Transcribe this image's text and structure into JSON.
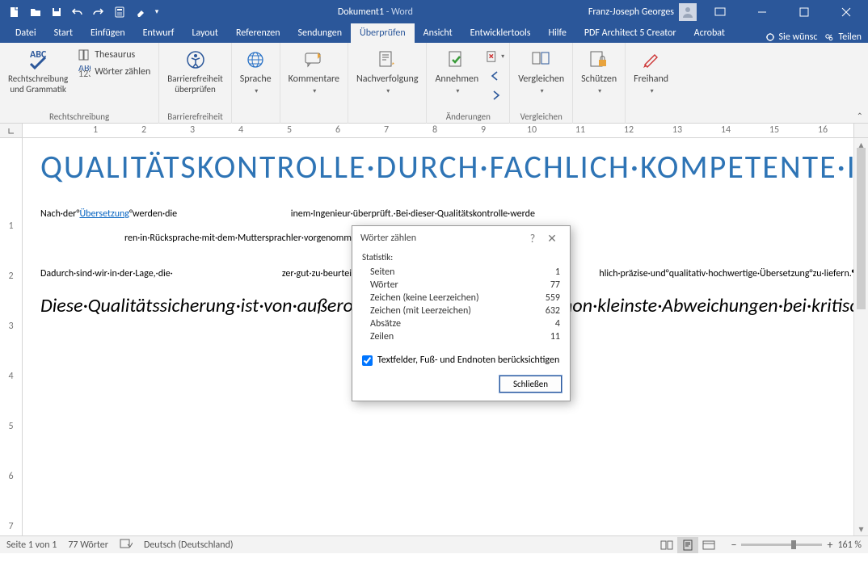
{
  "title": {
    "doc": "Dokument1",
    "sep": " - ",
    "app": "Word",
    "user": "Franz-Joseph Georges"
  },
  "tabs": {
    "datei": "Datei",
    "start": "Start",
    "einf": "Einfügen",
    "entw": "Entwurf",
    "layout": "Layout",
    "ref": "Referenzen",
    "send": "Sendungen",
    "uber": "Überprüfen",
    "ans": "Ansicht",
    "dev": "Entwicklertools",
    "hilfe": "Hilfe",
    "pdf": "PDF Architect 5 Creator",
    "acro": "Acrobat",
    "wunsch": "Sie wünsc",
    "teilen": "Teilen"
  },
  "ribbon": {
    "g1": {
      "label": "Rechtschreibung",
      "btn1": "Rechtschreibung\nund Grammatik",
      "thes": "Thesaurus",
      "wz": "Wörter zählen"
    },
    "g2": {
      "label": "Barrierefreiheit",
      "btn": "Barrierefreiheit\nüberprüfen"
    },
    "g3": {
      "label": "",
      "btn": "Sprache"
    },
    "g4": {
      "label": "",
      "btn": "Kommentare"
    },
    "g5": {
      "label": "",
      "btn": "Nachverfolgung"
    },
    "g6": {
      "label": "Änderungen",
      "btn": "Annehmen"
    },
    "g7": {
      "label": "Vergleichen",
      "btn": "Vergleichen"
    },
    "g8": {
      "label": "",
      "btn": "Schützen"
    },
    "g9": {
      "label": "",
      "btn": "Freihand"
    }
  },
  "ruler": {
    "nums": [
      "",
      "1",
      "2",
      "3",
      "4",
      "5",
      "6",
      "7",
      "8",
      "9",
      "10",
      "11",
      "12",
      "13",
      "14",
      "15",
      "16"
    ]
  },
  "doc": {
    "h1": "QUALITÄTSKONTROLLE·DURCH·FACHLICH·KOMPETENTE·INGENIEURE¶",
    "p1a": "Nach·der°",
    "p1link": "Übersetzung",
    "p1b": "°werden·die",
    "p1c": "inem·Ingenieur·überprüft.·Bei·dieser·Qualitätskontrolle·werde",
    "p1d": "ren·in·Rücksprache·mit·dem·Muttersprachler·vorgenomme",
    "p2a": "Dadurch·sind·wir·in·der·Lage,·die·",
    "p2b": "zer·gut·zu·beurteilen·und·zu·klassifizieren,·sowie·unseren·K",
    "p2c": "hlich·präzise·und°qualitativ·hochwertige·Übersetzung°zu·liefern.¶",
    "p3": "Diese·Qualitätssicherung·ist·von·außerordentlicher·Relevanz,·da·schon·kleinste·Abweichungen·bei·kritischen·Beschreibungen·und·Anweisungen·zu·erheblichen·Auswirkungen·führen·können.¶"
  },
  "dialog": {
    "title": "Wörter zählen",
    "stat": "Statistik:",
    "rows": [
      {
        "k": "Seiten",
        "v": "1"
      },
      {
        "k": "Wörter",
        "v": "77"
      },
      {
        "k": "Zeichen (keine Leerzeichen)",
        "v": "559"
      },
      {
        "k": "Zeichen (mit Leerzeichen)",
        "v": "632"
      },
      {
        "k": "Absätze",
        "v": "4"
      },
      {
        "k": "Zeilen",
        "v": "11"
      }
    ],
    "checkbox": "Textfelder, Fuß- und Endnoten berücksichtigen",
    "close": "Schließen"
  },
  "status": {
    "page": "Seite 1 von 1",
    "words": "77 Wörter",
    "lang": "Deutsch (Deutschland)",
    "zoom": "161 %"
  }
}
